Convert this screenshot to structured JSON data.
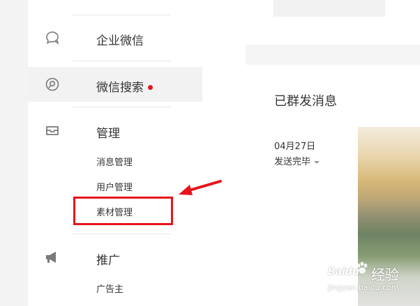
{
  "sidebar": {
    "nav": [
      {
        "label": "企业微信",
        "icon": "chat-bubble-icon"
      },
      {
        "label": "微信搜索",
        "icon": "search-circle-icon",
        "active": true,
        "badge_dot": true
      },
      {
        "label": "管理",
        "icon": "inbox-tray-icon"
      },
      {
        "label": "推广",
        "icon": "megaphone-icon"
      }
    ],
    "management_items": [
      "消息管理",
      "用户管理",
      "素材管理"
    ],
    "promotion_items": [
      "广告主"
    ],
    "highlighted_item": "素材管理"
  },
  "main": {
    "section_title": "已群发消息",
    "message": {
      "date": "04月27日",
      "status": "发送完毕"
    }
  },
  "watermark": {
    "brand": "Baidu",
    "cn": "经验",
    "url": "jingyan.baidu.com"
  },
  "colors": {
    "annotation_red": "#e8131b",
    "badge_red": "#e0191c",
    "active_row_bg": "#f2f2f2"
  }
}
